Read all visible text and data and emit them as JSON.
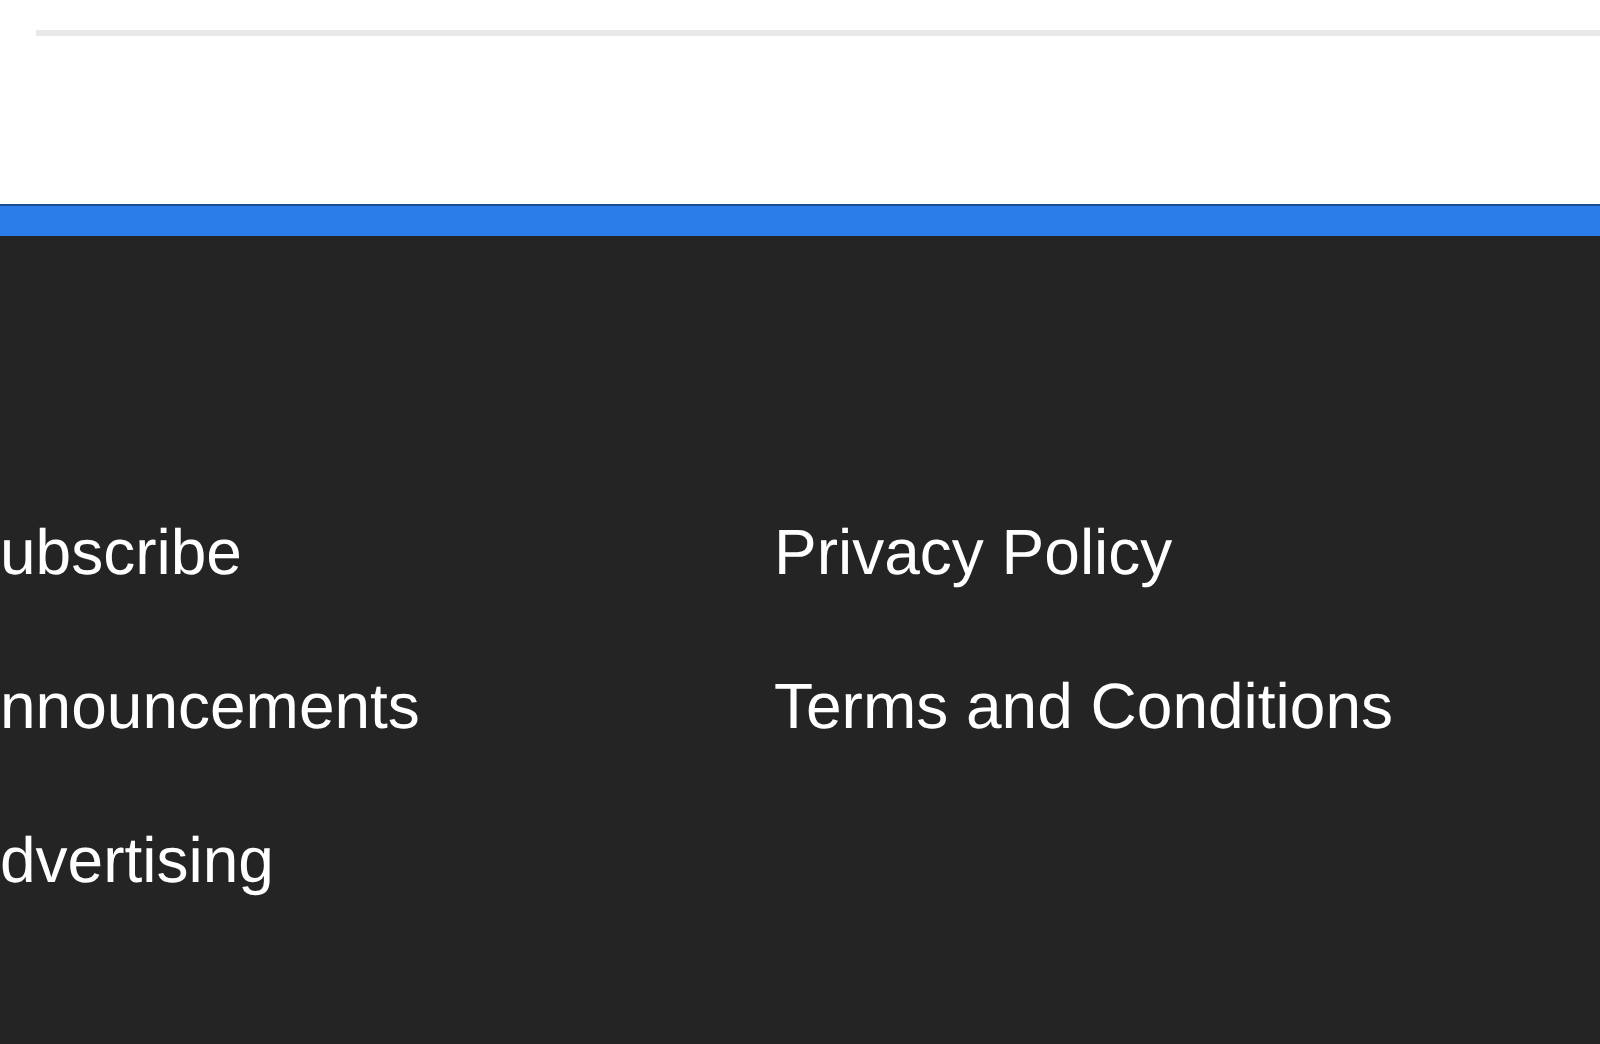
{
  "footer": {
    "columns": [
      {
        "links": [
          "ubscribe",
          "nnouncements",
          "dvertising"
        ]
      },
      {
        "links": [
          "Privacy Policy",
          "Terms and Conditions"
        ]
      }
    ]
  }
}
